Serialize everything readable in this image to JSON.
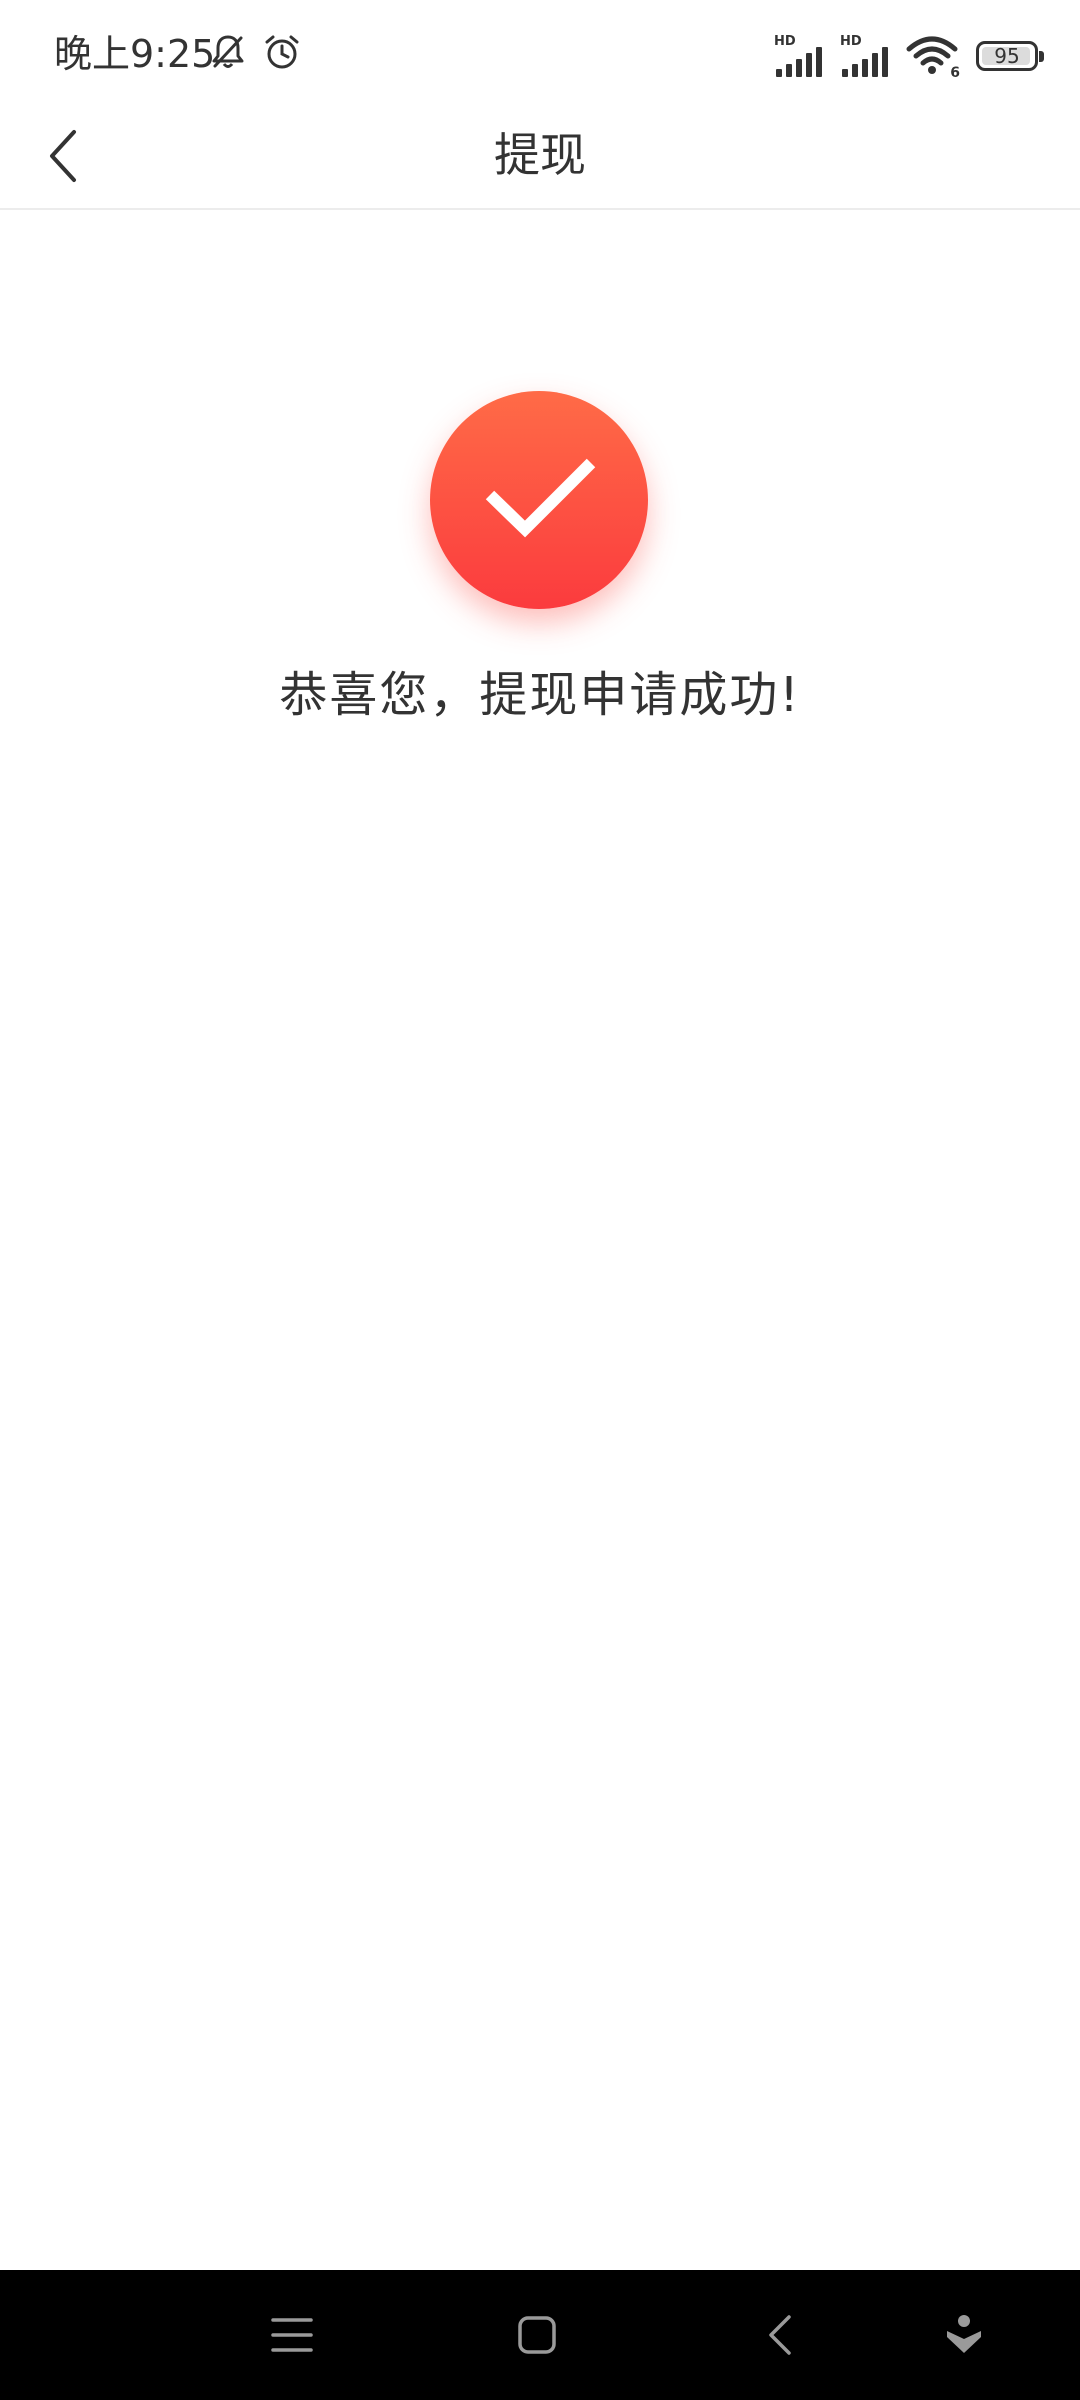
{
  "status_bar": {
    "time": "晚上9:25",
    "icons": [
      "bell-muted-icon",
      "alarm-icon"
    ],
    "signal_1_label": "HD",
    "signal_2_label": "HD",
    "wifi_label": "6",
    "battery": "95",
    "battery_level": 0.95
  },
  "header": {
    "title": "提现",
    "back_icon": "chevron-left-icon"
  },
  "content": {
    "success_icon": "checkmark-icon",
    "message": "恭喜您，提现申请成功!",
    "accent_colors": [
      "#ff6b47",
      "#fb3b3e"
    ]
  },
  "system_nav": {
    "buttons": [
      "menu-icon",
      "home-icon",
      "back-icon",
      "assistant-icon"
    ],
    "background": "#000000"
  }
}
